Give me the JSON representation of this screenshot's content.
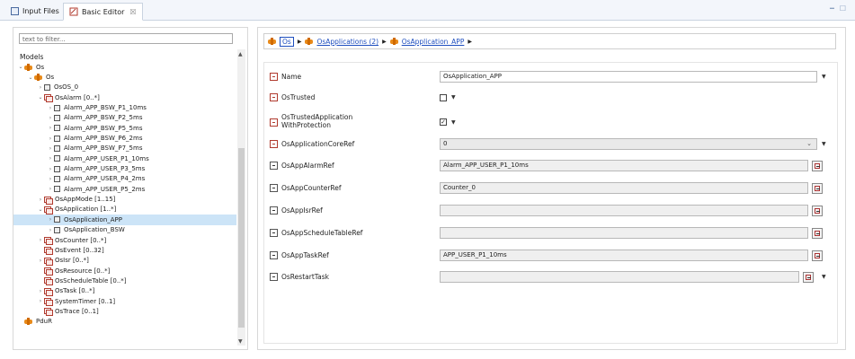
{
  "tabs": [
    {
      "label": "Input Files",
      "active": false
    },
    {
      "label": "Basic Editor",
      "active": true,
      "close": "☒"
    }
  ],
  "left": {
    "filter_placeholder": "text to filter...",
    "models_label": "Models",
    "tree": [
      {
        "label": "Os",
        "depth": 0,
        "twisty": "v",
        "icon": "root"
      },
      {
        "label": "Os",
        "depth": 1,
        "twisty": "v",
        "icon": "root"
      },
      {
        "label": "OsOS_0",
        "depth": 2,
        "twisty": ">",
        "icon": "box"
      },
      {
        "label": "OsAlarm [0..*]",
        "depth": 2,
        "twisty": "v",
        "icon": "cont"
      },
      {
        "label": "Alarm_APP_BSW_P1_10ms",
        "depth": 3,
        "twisty": ">",
        "icon": "box"
      },
      {
        "label": "Alarm_APP_BSW_P2_5ms",
        "depth": 3,
        "twisty": ">",
        "icon": "box"
      },
      {
        "label": "Alarm_APP_BSW_P5_5ms",
        "depth": 3,
        "twisty": ">",
        "icon": "box"
      },
      {
        "label": "Alarm_APP_BSW_P6_2ms",
        "depth": 3,
        "twisty": ">",
        "icon": "box"
      },
      {
        "label": "Alarm_APP_BSW_P7_5ms",
        "depth": 3,
        "twisty": ">",
        "icon": "box"
      },
      {
        "label": "Alarm_APP_USER_P1_10ms",
        "depth": 3,
        "twisty": ">",
        "icon": "box"
      },
      {
        "label": "Alarm_APP_USER_P3_5ms",
        "depth": 3,
        "twisty": ">",
        "icon": "box"
      },
      {
        "label": "Alarm_APP_USER_P4_2ms",
        "depth": 3,
        "twisty": ">",
        "icon": "box"
      },
      {
        "label": "Alarm_APP_USER_P5_2ms",
        "depth": 3,
        "twisty": ">",
        "icon": "box"
      },
      {
        "label": "OsAppMode [1..15]",
        "depth": 2,
        "twisty": ">",
        "icon": "cont"
      },
      {
        "label": "OsApplication [1..*]",
        "depth": 2,
        "twisty": "v",
        "icon": "cont"
      },
      {
        "label": "OsApplication_APP",
        "depth": 3,
        "twisty": ">",
        "icon": "box",
        "selected": true
      },
      {
        "label": "OsApplication_BSW",
        "depth": 3,
        "twisty": ">",
        "icon": "box"
      },
      {
        "label": "OsCounter [0..*]",
        "depth": 2,
        "twisty": ">",
        "icon": "cont"
      },
      {
        "label": "OsEvent [0..32]",
        "depth": 2,
        "twisty": "",
        "icon": "cont"
      },
      {
        "label": "OsIsr [0..*]",
        "depth": 2,
        "twisty": ">",
        "icon": "cont"
      },
      {
        "label": "OsResource [0..*]",
        "depth": 2,
        "twisty": "",
        "icon": "cont"
      },
      {
        "label": "OsScheduleTable [0..*]",
        "depth": 2,
        "twisty": "",
        "icon": "cont"
      },
      {
        "label": "OsTask [0..*]",
        "depth": 2,
        "twisty": ">",
        "icon": "cont"
      },
      {
        "label": "SystemTimer [0..1]",
        "depth": 2,
        "twisty": ">",
        "icon": "cont"
      },
      {
        "label": "OsTrace [0..1]",
        "depth": 2,
        "twisty": "",
        "icon": "cont"
      },
      {
        "label": "PduR",
        "depth": 0,
        "twisty": "",
        "icon": "root"
      }
    ]
  },
  "breadcrumb": {
    "root": "Os",
    "items": [
      "OsApplications (2)",
      "OsApplication_APP"
    ]
  },
  "form": {
    "name": {
      "label": "Name",
      "value": "OsApplication_APP"
    },
    "trusted": {
      "label": "OsTrusted",
      "checked": false
    },
    "trusted_app": {
      "label_line1": "OsTrustedApplication",
      "label_line2": "WithProtection",
      "checked": true
    },
    "core_ref": {
      "label": "OsApplicationCoreRef",
      "value": "0"
    },
    "alarm_ref": {
      "label": "OsAppAlarmRef",
      "value": "Alarm_APP_USER_P1_10ms"
    },
    "counter_ref": {
      "label": "OsAppCounterRef",
      "value": "Counter_0"
    },
    "isr_ref": {
      "label": "OsAppIsrRef",
      "value": ""
    },
    "sched_ref": {
      "label": "OsAppScheduleTableRef",
      "value": ""
    },
    "task_ref": {
      "label": "OsAppTaskRef",
      "value": "APP_USER_P1_10ms"
    },
    "restart": {
      "label": "OsRestartTask",
      "value": ""
    }
  }
}
